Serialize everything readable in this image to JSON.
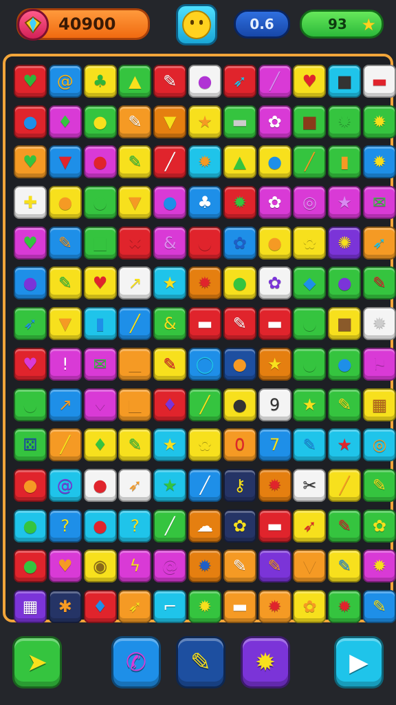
{
  "hud": {
    "score": "40900",
    "level": "0.6",
    "moves": "93",
    "score_icon": "gem-icon",
    "avatar_icon": "smiley-face-icon",
    "moves_icon": "star-icon"
  },
  "palette": {
    "G": "#35c43f",
    "B": "#1e8fe8",
    "Y": "#f7e01d",
    "R": "#e0242c",
    "W": "#f4f4f4",
    "P": "#d93ad6",
    "C": "#1fc4ea",
    "K": "#e57f10",
    "O": "#f59a24",
    "V": "#7b34d8",
    "M": "#1d4fa0",
    "N": "#253466"
  },
  "board": {
    "rows": [
      [
        [
          "R",
          "heart-icon",
          "♥",
          "#2fb53a"
        ],
        [
          "B",
          "swirl-icon",
          "@",
          "#f2b21a"
        ],
        [
          "Y",
          "leaf-icon",
          "♣",
          "#2fb53a"
        ],
        [
          "G",
          "cake-icon",
          "▲",
          "#f7e01d"
        ],
        [
          "R",
          "pencil-icon",
          "✎",
          "#ffffff"
        ],
        [
          "W",
          "grape-icon",
          "●",
          "#b033d4"
        ],
        [
          "R",
          "feather-icon",
          "➶",
          "#1fc4ea"
        ],
        [
          "P",
          "pencil-icon",
          "╱",
          "#d88af0"
        ],
        [
          "Y",
          "heart-icon",
          "♥",
          "#e0242c"
        ],
        [
          "C",
          "jar-icon",
          "■",
          "#333333"
        ],
        [
          "W",
          "gift-icon",
          "▬",
          "#e0242c"
        ]
      ],
      [
        [
          "R",
          "bubble-icon",
          "●",
          "#1e8fe8"
        ],
        [
          "P",
          "leaf-icon",
          "♦",
          "#35c43f"
        ],
        [
          "G",
          "blob-icon",
          "●",
          "#f7e01d"
        ],
        [
          "O",
          "pencil-icon",
          "✎",
          "#ffffff"
        ],
        [
          "K",
          "carrot-icon",
          "▼",
          "#f7e01d"
        ],
        [
          "Y",
          "star-icon",
          "★",
          "#f59a24"
        ],
        [
          "G",
          "box-icon",
          "▬",
          "#cccccc"
        ],
        [
          "P",
          "cloud-icon",
          "✿",
          "#ffffff"
        ],
        [
          "G",
          "frame-icon",
          "■",
          "#8a3a1a"
        ],
        [
          "G",
          "gear-icon",
          "✹",
          "#35c43f"
        ],
        [
          "G",
          "flower-icon",
          "✹",
          "#f7e01d"
        ]
      ],
      [
        [
          "O",
          "heart-icon",
          "♥",
          "#35c43f"
        ],
        [
          "B",
          "carrot-icon",
          "▼",
          "#e0242c"
        ],
        [
          "P",
          "apple-icon",
          "●",
          "#e0242c"
        ],
        [
          "Y",
          "pencil-icon",
          "✎",
          "#35c43f"
        ],
        [
          "R",
          "pencil-icon",
          "╱",
          "#ffffff"
        ],
        [
          "C",
          "flower-icon",
          "✹",
          "#f59a24"
        ],
        [
          "Y",
          "house-icon",
          "▲",
          "#35c43f"
        ],
        [
          "Y",
          "leaf-icon",
          "●",
          "#1e8fe8"
        ],
        [
          "G",
          "pencil-icon",
          "╱",
          "#f59a24"
        ],
        [
          "G",
          "bottle-icon",
          "▮",
          "#f59a24"
        ],
        [
          "B",
          "flower-icon",
          "✹",
          "#f7e01d"
        ]
      ],
      [
        [
          "W",
          "cross-icon",
          "✚",
          "#f7e01d"
        ],
        [
          "Y",
          "shell-icon",
          "●",
          "#f59a24"
        ],
        [
          "G",
          "gourd-icon",
          "●",
          "#35c43f"
        ],
        [
          "Y",
          "carrot-icon",
          "▼",
          "#f59a24"
        ],
        [
          "P",
          "bowl-icon",
          "●",
          "#1e8fe8"
        ],
        [
          "B",
          "tree-icon",
          "♣",
          "#ffffff"
        ],
        [
          "R",
          "gear-icon",
          "✹",
          "#35c43f"
        ],
        [
          "P",
          "cloud-icon",
          "✿",
          "#ffffff"
        ],
        [
          "P",
          "ring-icon",
          "◎",
          "#e08af0"
        ],
        [
          "P",
          "star-icon",
          "★",
          "#d88af0"
        ],
        [
          "P",
          "mail-icon",
          "✉",
          "#35c43f"
        ]
      ],
      [
        [
          "P",
          "heart-icon",
          "♥",
          "#35c43f"
        ],
        [
          "B",
          "pencil-icon",
          "✎",
          "#f59a24"
        ],
        [
          "G",
          "jar-icon",
          "■",
          "#35c43f"
        ],
        [
          "R",
          "cross-icon",
          "✖",
          "#e0242c"
        ],
        [
          "P",
          "ampersand-icon",
          "&",
          "#e08af0"
        ],
        [
          "R",
          "blob-icon",
          "●",
          "#e0242c"
        ],
        [
          "B",
          "blob-icon",
          "✿",
          "#1e5fc8"
        ],
        [
          "Y",
          "coin-icon",
          "●",
          "#f59a24"
        ],
        [
          "Y",
          "flower-icon",
          "✿",
          "#f7e01d"
        ],
        [
          "V",
          "sun-icon",
          "✺",
          "#f7e01d"
        ],
        [
          "O",
          "pencil-icon",
          "➶",
          "#1fc4ea"
        ]
      ],
      [
        [
          "B",
          "grape-icon",
          "●",
          "#7b34d8"
        ],
        [
          "Y",
          "pencil-icon",
          "✎",
          "#35c43f"
        ],
        [
          "Y",
          "heart-icon",
          "♥",
          "#e0242c"
        ],
        [
          "W",
          "pencil-icon",
          "↗",
          "#f7e01d"
        ],
        [
          "C",
          "star-icon",
          "★",
          "#f7e01d"
        ],
        [
          "K",
          "flower-icon",
          "✹",
          "#e0242c"
        ],
        [
          "Y",
          "cabbage-icon",
          "●",
          "#35c43f"
        ],
        [
          "W",
          "cloud-icon",
          "✿",
          "#7b34d8"
        ],
        [
          "G",
          "diamond-icon",
          "◆",
          "#1e8fe8"
        ],
        [
          "G",
          "grape-icon",
          "●",
          "#7b34d8"
        ],
        [
          "G",
          "pencil-icon",
          "✎",
          "#e0242c"
        ]
      ],
      [
        [
          "G",
          "bird-icon",
          "➶",
          "#1e8fe8"
        ],
        [
          "Y",
          "carrot-icon",
          "▼",
          "#f59a24"
        ],
        [
          "C",
          "bottle-icon",
          "▮",
          "#1e8fe8"
        ],
        [
          "B",
          "pencil-icon",
          "╱",
          "#f7e01d"
        ],
        [
          "G",
          "ampersand-icon",
          "&",
          "#f7e01d"
        ],
        [
          "R",
          "bandage-icon",
          "▬",
          "#ffffff"
        ],
        [
          "R",
          "pencil-icon",
          "✎",
          "#ffffff"
        ],
        [
          "R",
          "ruler-icon",
          "▬",
          "#ffffff"
        ],
        [
          "G",
          "bubble-icon",
          "●",
          "#35c43f"
        ],
        [
          "Y",
          "cake-icon",
          "■",
          "#8a5a2a"
        ],
        [
          "W",
          "splat-icon",
          "✹",
          "#cccccc"
        ]
      ],
      [
        [
          "R",
          "heart-icon",
          "♥",
          "#d93ad6"
        ],
        [
          "P",
          "exclaim-icon",
          "!",
          "#ffffff"
        ],
        [
          "P",
          "mail-icon",
          "✉",
          "#35c43f"
        ],
        [
          "O",
          "bell-icon",
          "▲",
          "#f59a24"
        ],
        [
          "Y",
          "pencil-icon",
          "✎",
          "#e0242c"
        ],
        [
          "B",
          "ring-icon",
          "◯",
          "#1fc4ea"
        ],
        [
          "M",
          "bread-icon",
          "●",
          "#f59a24"
        ],
        [
          "K",
          "star-icon",
          "★",
          "#f7e01d"
        ],
        [
          "G",
          "pill-icon",
          "●",
          "#35c43f"
        ],
        [
          "G",
          "dot-icon",
          "●",
          "#1e8fe8"
        ],
        [
          "P",
          "flag-icon",
          "⚑",
          "#d93ad6"
        ]
      ],
      [
        [
          "G",
          "bubble-icon",
          "●",
          "#35c43f"
        ],
        [
          "B",
          "pencil-icon",
          "↗",
          "#f59a24"
        ],
        [
          "P",
          "leaf-icon",
          "♦",
          "#d93ad6"
        ],
        [
          "O",
          "chest-icon",
          "■",
          "#f59a24"
        ],
        [
          "R",
          "leaf-icon",
          "♦",
          "#7b34d8"
        ],
        [
          "G",
          "pencil-icon",
          "╱",
          "#f7e01d"
        ],
        [
          "Y",
          "egg-icon",
          "●",
          "#333333"
        ],
        [
          "W",
          "nine-icon",
          "9",
          "#333333"
        ],
        [
          "G",
          "star-icon",
          "★",
          "#f7e01d"
        ],
        [
          "G",
          "pencil-icon",
          "✎",
          "#f7e01d"
        ],
        [
          "Y",
          "basket-icon",
          "▦",
          "#b5651d"
        ]
      ],
      [
        [
          "G",
          "dice-icon",
          "⚄",
          "#1d4fa0"
        ],
        [
          "O",
          "pencil-icon",
          "╱",
          "#f7e01d"
        ],
        [
          "Y",
          "leaf-icon",
          "♦",
          "#35c43f"
        ],
        [
          "Y",
          "pencil-icon",
          "✎",
          "#35c43f"
        ],
        [
          "C",
          "star-icon",
          "★",
          "#f7e01d"
        ],
        [
          "Y",
          "flower-icon",
          "✿",
          "#f7e01d"
        ],
        [
          "O",
          "zero-icon",
          "0",
          "#e0242c"
        ],
        [
          "B",
          "seven-icon",
          "7",
          "#f7e01d"
        ],
        [
          "C",
          "pencil-icon",
          "✎",
          "#1e8fe8"
        ],
        [
          "C",
          "star-icon",
          "★",
          "#e0242c"
        ],
        [
          "C",
          "ring-icon",
          "◎",
          "#f59a24"
        ]
      ],
      [
        [
          "R",
          "coin-icon",
          "●",
          "#f59a24"
        ],
        [
          "C",
          "swirl-icon",
          "@",
          "#7b34d8"
        ],
        [
          "W",
          "apple-icon",
          "●",
          "#e0242c"
        ],
        [
          "W",
          "bird-icon",
          "➶",
          "#f59a24"
        ],
        [
          "C",
          "star-icon",
          "★",
          "#35c43f"
        ],
        [
          "B",
          "pencil-icon",
          "╱",
          "#ffffff"
        ],
        [
          "N",
          "key-icon",
          "⚷",
          "#f7e01d"
        ],
        [
          "K",
          "flower-icon",
          "✹",
          "#e0242c"
        ],
        [
          "W",
          "scissors-icon",
          "✂",
          "#333333"
        ],
        [
          "Y",
          "pencil-icon",
          "╱",
          "#f59a24"
        ],
        [
          "G",
          "pencil-icon",
          "✎",
          "#f7e01d"
        ]
      ],
      [
        [
          "C",
          "bubble-icon",
          "●",
          "#35c43f"
        ],
        [
          "B",
          "hook-icon",
          "?",
          "#f7e01d"
        ],
        [
          "C",
          "apple-icon",
          "●",
          "#e0242c"
        ],
        [
          "C",
          "hook-icon",
          "?",
          "#f7e01d"
        ],
        [
          "G",
          "pencil-icon",
          "╱",
          "#ffffff"
        ],
        [
          "K",
          "cloud-icon",
          "☁",
          "#ffffff"
        ],
        [
          "N",
          "flower-icon",
          "✿",
          "#f7e01d"
        ],
        [
          "R",
          "ruler-icon",
          "▬",
          "#ffffff"
        ],
        [
          "Y",
          "feather-icon",
          "➶",
          "#e0242c"
        ],
        [
          "G",
          "pencil-icon",
          "✎",
          "#e0242c"
        ],
        [
          "G",
          "flower-icon",
          "✿",
          "#f7e01d"
        ]
      ],
      [
        [
          "R",
          "coin-icon",
          "●",
          "#35c43f"
        ],
        [
          "P",
          "heart-icon",
          "♥",
          "#f59a24"
        ],
        [
          "Y",
          "shell-icon",
          "◉",
          "#8a6a1a"
        ],
        [
          "P",
          "bolt-icon",
          "ϟ",
          "#f7e01d"
        ],
        [
          "P",
          "swirl-icon",
          "@",
          "#d93ad6"
        ],
        [
          "K",
          "gear-icon",
          "✹",
          "#1e5fc8"
        ],
        [
          "O",
          "pencil-icon",
          "✎",
          "#ffffff"
        ],
        [
          "V",
          "pencil-icon",
          "✎",
          "#f59a24"
        ],
        [
          "O",
          "flask-icon",
          "▼",
          "#f59a24"
        ],
        [
          "Y",
          "pencil-icon",
          "✎",
          "#1e8fe8"
        ],
        [
          "P",
          "flower-icon",
          "✹",
          "#f7e01d"
        ]
      ],
      [
        [
          "V",
          "grid-icon",
          "▦",
          "#ffffff"
        ],
        [
          "N",
          "gingerbread-icon",
          "✱",
          "#f59a24"
        ],
        [
          "R",
          "leaf-icon",
          "♦",
          "#1e8fe8"
        ],
        [
          "O",
          "bird-icon",
          "➶",
          "#f7e01d"
        ],
        [
          "C",
          "hook-icon",
          "⌐",
          "#ffffff"
        ],
        [
          "G",
          "flower-icon",
          "✹",
          "#f7e01d"
        ],
        [
          "O",
          "ruler-icon",
          "▬",
          "#ffffff"
        ],
        [
          "O",
          "flower-icon",
          "✹",
          "#e0242c"
        ],
        [
          "Y",
          "cloud-icon",
          "✿",
          "#f59a24"
        ],
        [
          "G",
          "gear-icon",
          "✹",
          "#e0242c"
        ],
        [
          "B",
          "pencil-icon",
          "✎",
          "#f7e01d"
        ]
      ]
    ]
  },
  "controls": [
    {
      "name": "send-button",
      "icon": "paper-plane-icon",
      "glyph": "➤",
      "bg": "#35c43f",
      "fg": "#f7e01d",
      "pos": 0
    },
    {
      "name": "call-button",
      "icon": "phone-icon",
      "glyph": "✆",
      "bg": "#1e8fe8",
      "fg": "#d93ad6",
      "pos": 1
    },
    {
      "name": "pencil-button",
      "icon": "pencil-icon",
      "glyph": "✎",
      "bg": "#1d4fa0",
      "fg": "#f7e01d",
      "pos": 2
    },
    {
      "name": "star-button",
      "icon": "star-icon",
      "glyph": "✹",
      "bg": "#7b34d8",
      "fg": "#f7e01d",
      "pos": 3
    },
    {
      "name": "play-button",
      "icon": "play-icon",
      "glyph": "▶",
      "bg": "#1fc4ea",
      "fg": "#ffffff",
      "pos": 4
    }
  ]
}
